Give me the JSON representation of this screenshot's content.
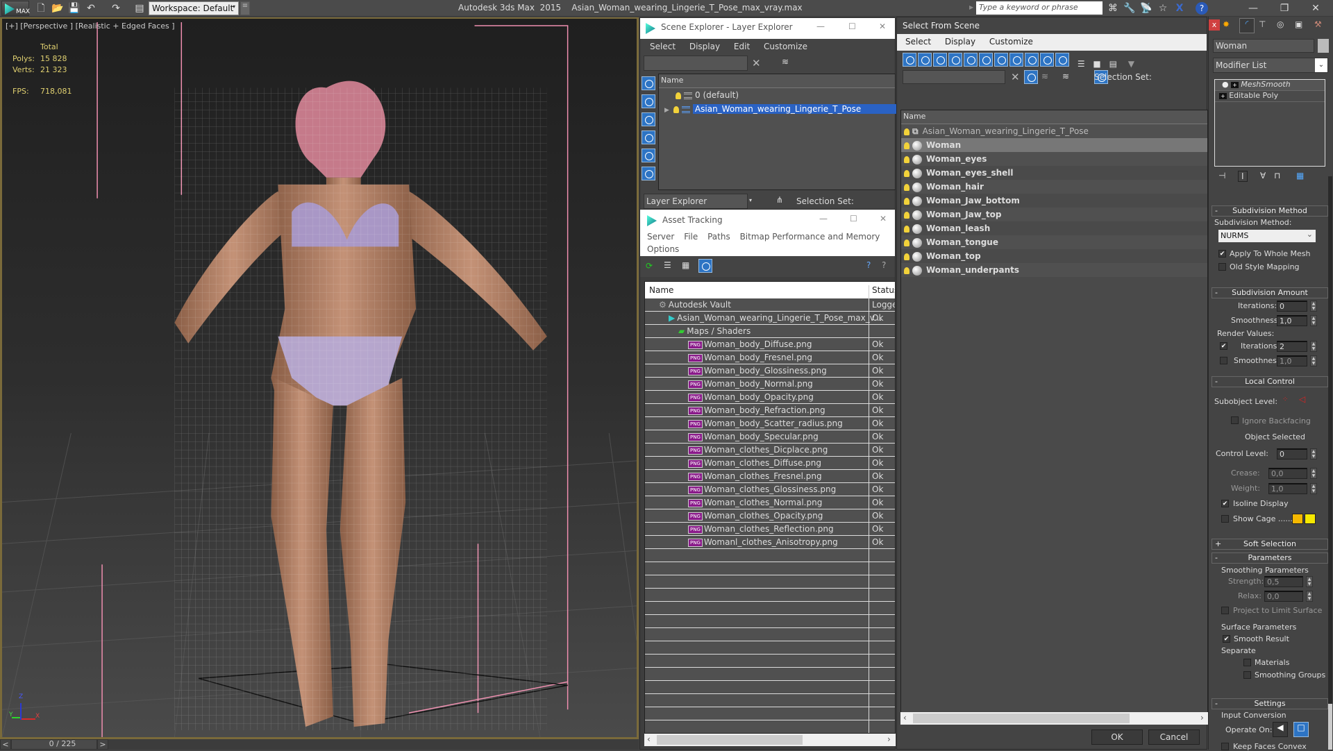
{
  "app": {
    "title": "Autodesk 3ds Max  2015    Asian_Woman_wearing_Lingerie_T_Pose_max_vray.max",
    "logo": "MAX",
    "workspace": "Workspace: Default",
    "search_placeholder": "Type a keyword or phrase",
    "toolbar_icons": [
      "new-file-icon",
      "open-file-icon",
      "save-icon",
      "undo-icon",
      "redo-icon",
      "project-icon"
    ],
    "right_icons": [
      "binoculars-icon",
      "key-icon",
      "satellite-icon",
      "star-icon",
      "x-icon",
      "help-icon"
    ]
  },
  "viewport": {
    "label": "[+] [Perspective ] [Realistic + Edged Faces ]",
    "stats": {
      "total_label": "Total",
      "polys_label": "Polys:",
      "polys": "15 828",
      "verts_label": "Verts:",
      "verts": "21 323",
      "fps_label": "FPS:",
      "fps": "718,081"
    },
    "axes": {
      "z": "Z",
      "x": "X",
      "y": "Y"
    },
    "accent": "#7a6a3a"
  },
  "timeline": {
    "position": "0 / 225",
    "prev": "<",
    "next": ">"
  },
  "scene_explorer": {
    "title": "Scene Explorer - Layer Explorer",
    "menu": [
      "Select",
      "Display",
      "Edit",
      "Customize"
    ],
    "column": "Name",
    "rows": [
      {
        "name": "0 (default)",
        "selected": false
      },
      {
        "name": "Asian_Woman_wearing_Lingerie_T_Pose",
        "selected": true
      }
    ],
    "footer_dropdown": "Layer Explorer",
    "selection_set_label": "Selection Set:",
    "highlight": "#2a62c4"
  },
  "asset_tracking": {
    "title": "Asset Tracking",
    "menu": [
      "Server",
      "File",
      "Paths",
      "Bitmap Performance and Memory",
      "Options"
    ],
    "columns": [
      "Name",
      "Status"
    ],
    "rows": [
      {
        "name": "Autodesk Vault",
        "status": "Logged",
        "indent": 1,
        "icon": "vault"
      },
      {
        "name": "Asian_Woman_wearing_Lingerie_T_Pose_max_v...",
        "status": "Ok",
        "indent": 2,
        "icon": "max"
      },
      {
        "name": "Maps / Shaders",
        "status": "",
        "indent": 3,
        "icon": "maps"
      },
      {
        "name": "Woman_body_Diffuse.png",
        "status": "Ok",
        "indent": 4,
        "icon": "png"
      },
      {
        "name": "Woman_body_Fresnel.png",
        "status": "Ok",
        "indent": 4,
        "icon": "png"
      },
      {
        "name": "Woman_body_Glossiness.png",
        "status": "Ok",
        "indent": 4,
        "icon": "png"
      },
      {
        "name": "Woman_body_Normal.png",
        "status": "Ok",
        "indent": 4,
        "icon": "png"
      },
      {
        "name": "Woman_body_Opacity.png",
        "status": "Ok",
        "indent": 4,
        "icon": "png"
      },
      {
        "name": "Woman_body_Refraction.png",
        "status": "Ok",
        "indent": 4,
        "icon": "png"
      },
      {
        "name": "Woman_body_Scatter_radius.png",
        "status": "Ok",
        "indent": 4,
        "icon": "png"
      },
      {
        "name": "Woman_body_Specular.png",
        "status": "Ok",
        "indent": 4,
        "icon": "png"
      },
      {
        "name": "Woman_clothes_Dicplace.png",
        "status": "Ok",
        "indent": 4,
        "icon": "png"
      },
      {
        "name": "Woman_clothes_Diffuse.png",
        "status": "Ok",
        "indent": 4,
        "icon": "png"
      },
      {
        "name": "Woman_clothes_Fresnel.png",
        "status": "Ok",
        "indent": 4,
        "icon": "png"
      },
      {
        "name": "Woman_clothes_Glossiness.png",
        "status": "Ok",
        "indent": 4,
        "icon": "png"
      },
      {
        "name": "Woman_clothes_Normal.png",
        "status": "Ok",
        "indent": 4,
        "icon": "png"
      },
      {
        "name": "Woman_clothes_Opacity.png",
        "status": "Ok",
        "indent": 4,
        "icon": "png"
      },
      {
        "name": "Woman_clothes_Reflection.png",
        "status": "Ok",
        "indent": 4,
        "icon": "png"
      },
      {
        "name": "Womanl_clothes_Anisotropy.png",
        "status": "Ok",
        "indent": 4,
        "icon": "png"
      }
    ],
    "png_badge": "PNG"
  },
  "select_from_scene": {
    "title": "Select From Scene",
    "menu": [
      "Select",
      "Display",
      "Customize"
    ],
    "selection_set_label": "Selection Set:",
    "column": "Name",
    "rows": [
      {
        "name": "Asian_Woman_wearing_Lingerie_T_Pose",
        "group": true,
        "selected": false
      },
      {
        "name": "Woman",
        "selected": true
      },
      {
        "name": "Woman_eyes",
        "selected": false
      },
      {
        "name": "Woman_eyes_shell",
        "selected": false
      },
      {
        "name": "Woman_hair",
        "selected": false
      },
      {
        "name": "Woman_Jaw_bottom",
        "selected": false
      },
      {
        "name": "Woman_Jaw_top",
        "selected": false
      },
      {
        "name": "Woman_leash",
        "selected": false
      },
      {
        "name": "Woman_tongue",
        "selected": false
      },
      {
        "name": "Woman_top",
        "selected": false
      },
      {
        "name": "Woman_underpants",
        "selected": false
      }
    ],
    "ok": "OK",
    "cancel": "Cancel",
    "close": "x"
  },
  "command_panel": {
    "object_name": "Woman",
    "modifier_list": "Modifier List",
    "stack": [
      "MeshSmooth",
      "Editable Poly"
    ],
    "subdivision_method": {
      "header": "Subdivision Method",
      "label": "Subdivision Method:",
      "value": "NURMS",
      "apply_whole_mesh": {
        "label": "Apply To Whole Mesh",
        "checked": true
      },
      "old_style_mapping": {
        "label": "Old Style Mapping",
        "checked": false
      }
    },
    "subdivision_amount": {
      "header": "Subdivision Amount",
      "iterations_label": "Iterations:",
      "iterations": "0",
      "smoothness_label": "Smoothness:",
      "smoothness": "1,0",
      "render_values_label": "Render Values:",
      "render_iterations": {
        "checked": true,
        "value": "2"
      },
      "render_smoothness": {
        "checked": false,
        "value": "1,0"
      }
    },
    "local_control": {
      "header": "Local Control",
      "subobject_label": "Subobject Level:",
      "ignore_backfacing": {
        "label": "Ignore Backfacing",
        "checked": false
      },
      "status": "Object Selected",
      "control_level_label": "Control Level:",
      "control_level": "0",
      "crease_label": "Crease:",
      "crease": "0,0",
      "weight_label": "Weight:",
      "weight": "1,0",
      "isoline_display": {
        "label": "Isoline Display",
        "checked": true
      },
      "show_cage": {
        "label": "Show Cage ......",
        "checked": false
      },
      "cage_colors": [
        "#f5b800",
        "#f5e800"
      ]
    },
    "soft_selection": {
      "header": "Soft Selection"
    },
    "parameters": {
      "header": "Parameters",
      "smoothing_group": "Smoothing Parameters",
      "strength_label": "Strength:",
      "strength": "0,5",
      "relax_label": "Relax:",
      "relax": "0,0",
      "project_limit": {
        "label": "Project to Limit Surface",
        "checked": false
      },
      "surface_group": "Surface Parameters",
      "smooth_result": {
        "label": "Smooth Result",
        "checked": true
      },
      "separate_label": "Separate",
      "materials": {
        "label": "Materials",
        "checked": false
      },
      "smoothing_groups": {
        "label": "Smoothing Groups",
        "checked": false
      }
    },
    "settings": {
      "header": "Settings",
      "input_conversion": "Input Conversion",
      "operate_on_label": "Operate On:",
      "keep_faces_convex": {
        "label": "Keep Faces Convex",
        "checked": false
      }
    }
  }
}
